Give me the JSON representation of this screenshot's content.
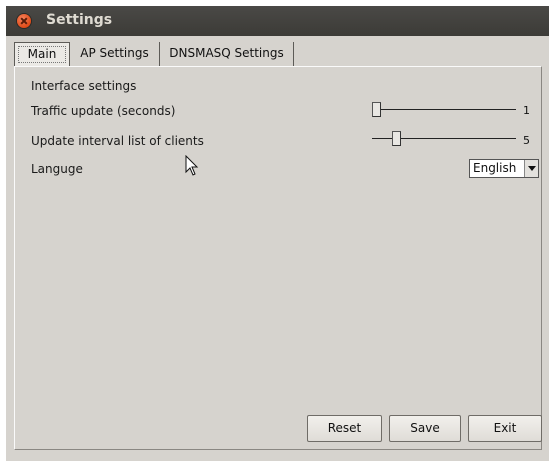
{
  "window": {
    "title": "Settings"
  },
  "tabs": [
    {
      "label": "Main",
      "active": true
    },
    {
      "label": "AP Settings",
      "active": false
    },
    {
      "label": "DNSMASQ Settings",
      "active": false
    }
  ],
  "main": {
    "section_title": "Interface settings",
    "traffic_update": {
      "label": "Traffic update (seconds)",
      "value": "1",
      "fraction": 0.0
    },
    "clients_interval": {
      "label": "Update interval list of clients",
      "value": "5",
      "fraction": 0.17
    },
    "language": {
      "label": "Languge",
      "selected": "English"
    }
  },
  "buttons": {
    "reset": "Reset",
    "save": "Save",
    "exit": "Exit"
  },
  "colors": {
    "window_bg": "#d6d3ce",
    "titlebar_bg": "#3c3b37",
    "close_button": "#df4a16"
  }
}
